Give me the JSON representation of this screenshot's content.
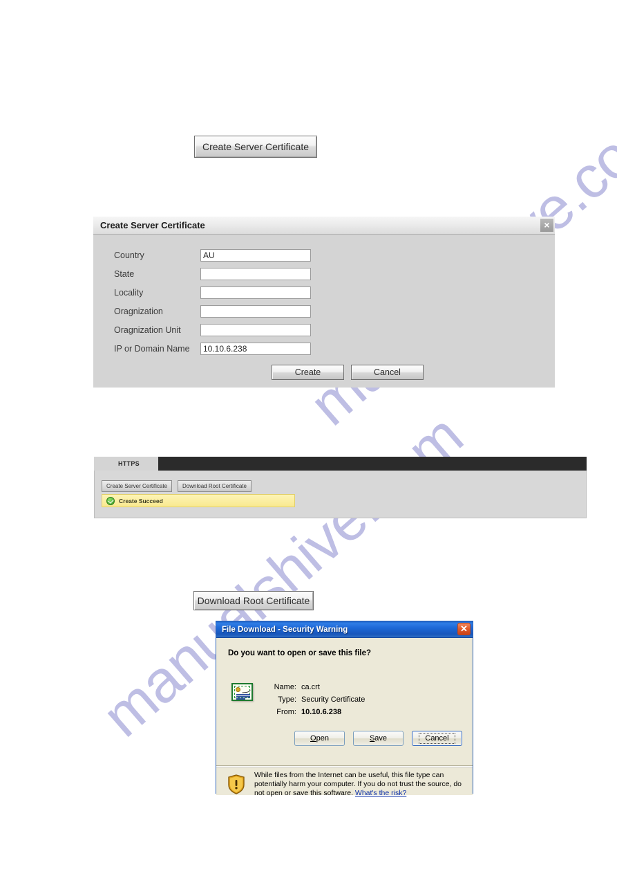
{
  "watermark": {
    "text": "manualshive.com",
    "color": "#b3b3e0"
  },
  "figure_create_button": {
    "label": "Create Server Certificate"
  },
  "create_certificate_dialog": {
    "title": "Create Server Certificate",
    "close_label": "×",
    "fields": [
      {
        "label": "Country",
        "value": "AU",
        "placeholder": ""
      },
      {
        "label": "State",
        "value": "",
        "placeholder": ""
      },
      {
        "label": "Locality",
        "value": "",
        "placeholder": ""
      },
      {
        "label": "Oragnization",
        "value": "",
        "placeholder": ""
      },
      {
        "label": "Oragnization Unit",
        "value": "",
        "placeholder": ""
      },
      {
        "label": "IP or Domain Name",
        "value": "10.10.6.238",
        "placeholder": ""
      }
    ],
    "buttons": {
      "create": "Create",
      "cancel": "Cancel"
    }
  },
  "https_panel": {
    "tab_label": "HTTPS",
    "buttons": {
      "create_server_certificate": "Create Server Certificate",
      "download_root_certificate": "Download Root Certificate"
    },
    "status": {
      "text": "Create Succeed",
      "icon": "success-check-icon",
      "background": "#f9e98f"
    }
  },
  "figure_download_button": {
    "label": "Download Root Certificate"
  },
  "file_download_dialog": {
    "title": "File Download - Security Warning",
    "close_label": "✕",
    "question": "Do you want to open or save this file?",
    "file_icon": "security-certificate-icon",
    "details": [
      {
        "key": "Name:",
        "value": "ca.crt",
        "bold": false
      },
      {
        "key": "Type:",
        "value": "Security Certificate",
        "bold": false
      },
      {
        "key": "From:",
        "value": "10.10.6.238",
        "bold": true
      }
    ],
    "buttons": {
      "open": "Open",
      "open_accel": "O",
      "save": "Save",
      "save_accel": "S",
      "cancel": "Cancel",
      "focused": "cancel"
    },
    "footer": {
      "icon": "warning-shield-icon",
      "text": "While files from the Internet can be useful, this file type can potentially harm your computer. If you do not trust the source, do not open or save this software.",
      "link": "What's the risk?"
    }
  }
}
